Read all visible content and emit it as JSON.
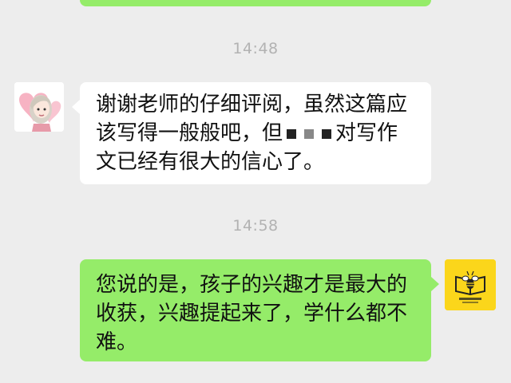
{
  "chat": {
    "timestamps": [
      "14:48",
      "14:58"
    ],
    "messages": [
      {
        "sender": "other",
        "avatar": "girl-cartoon-avatar",
        "line1": "谢谢老师的仔细评阅，虽然这篇应",
        "line2a": "该写得一般般吧，但",
        "line2b": "对写作",
        "line3": "文已经有很大的信心了。"
      },
      {
        "sender": "self",
        "avatar": "bee-book-logo",
        "line1": "您说的是，孩子的兴趣才是最大的",
        "line2": "收获，兴趣提起来了，学什么都不",
        "line3": "难。"
      }
    ]
  },
  "colors": {
    "background": "#ededed",
    "self_bubble": "#95ec69",
    "other_bubble": "#ffffff",
    "timestamp": "#b2b2b2",
    "logo_bg": "#fbd61b"
  }
}
